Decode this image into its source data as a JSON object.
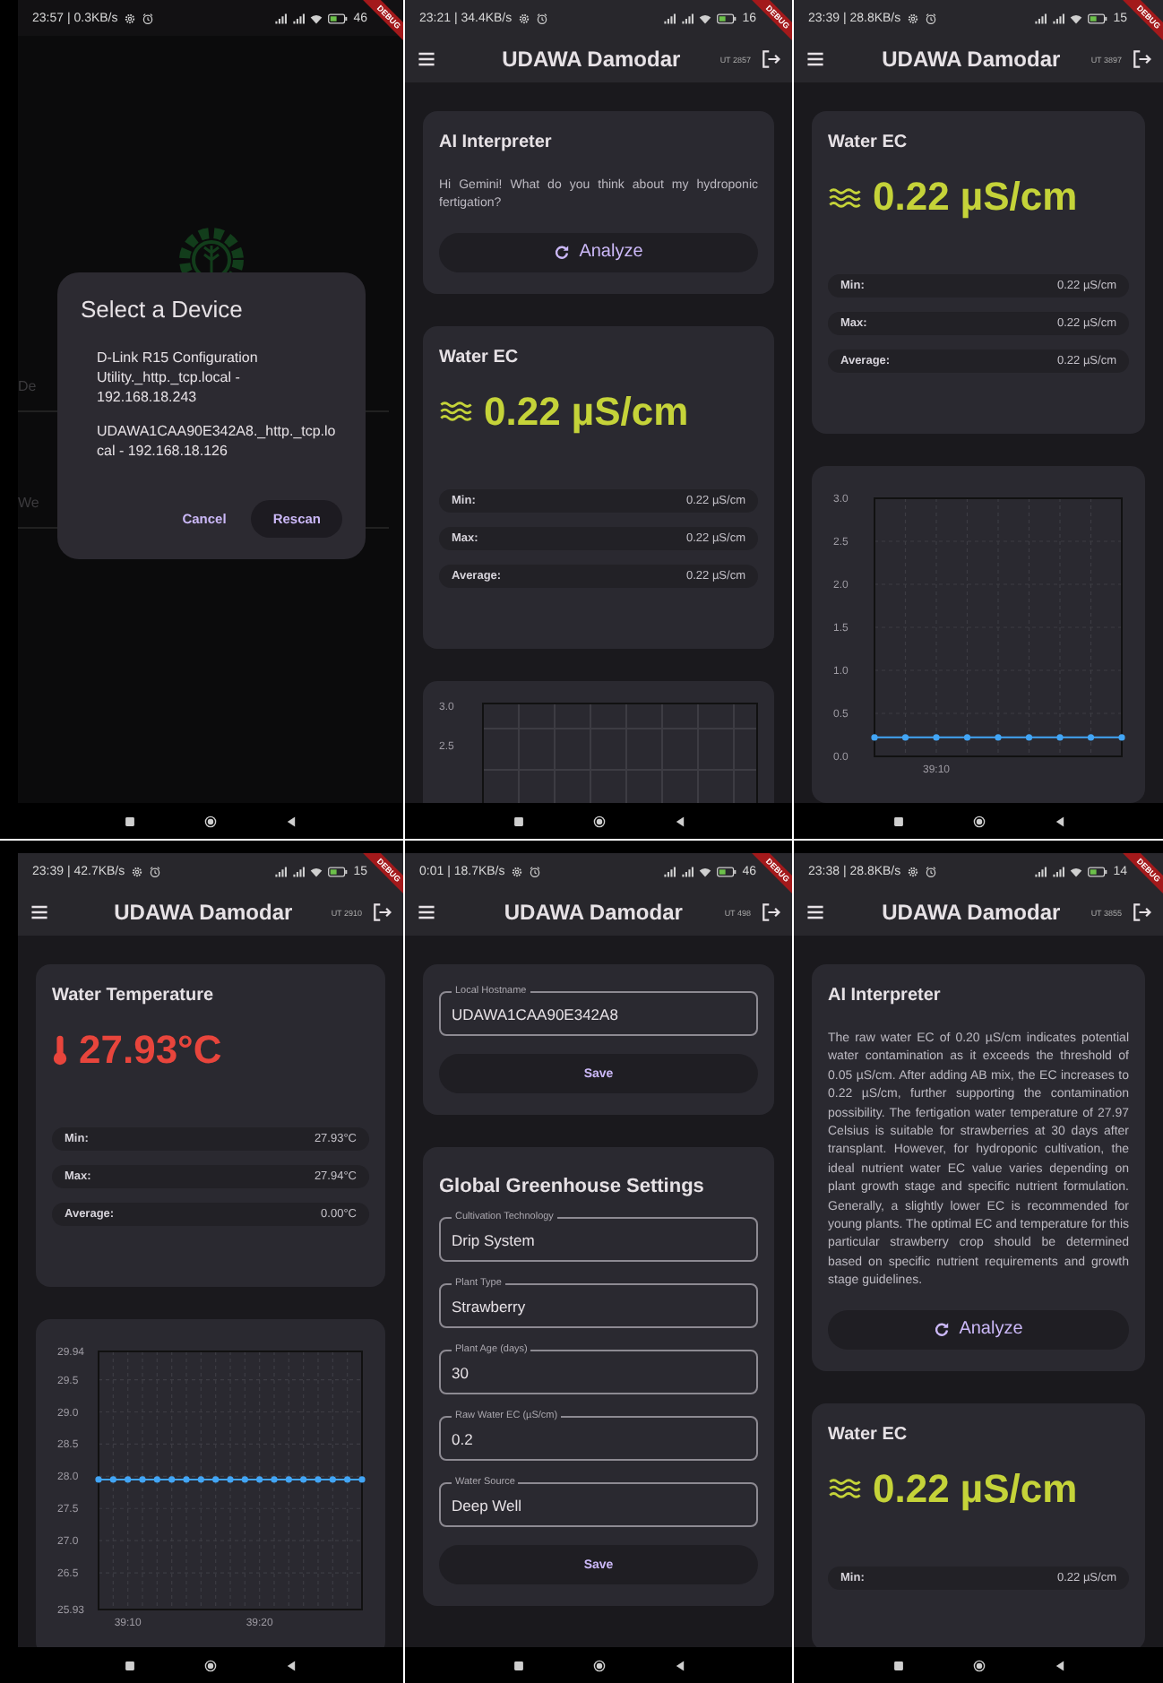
{
  "screens": [
    {
      "kind": "dialog",
      "status": {
        "text": "23:57 | 0.3KB/s",
        "battery": "46"
      },
      "debug_banner": "DEBUG",
      "background_labels": [
        "De",
        "We"
      ],
      "dialog": {
        "title": "Select a Device",
        "options": [
          "D-Link R15 Configuration Utility._http._tcp.local - 192.168.18.243",
          "UDAWA1CAA90E342A8._http._tcp.local - 192.168.18.126"
        ],
        "buttons": [
          {
            "label": "Cancel",
            "kind": "text"
          },
          {
            "label": "Rescan",
            "kind": "tonal"
          }
        ]
      }
    },
    {
      "kind": "app",
      "status": {
        "text": "23:21 | 34.4KB/s",
        "battery": "16"
      },
      "debug_banner": "DEBUG",
      "app_bar": {
        "title": "UDAWA Damodar",
        "uptime": "UT 2857"
      },
      "cards": [
        {
          "kind": "ai",
          "title": "AI Interpreter",
          "text": "Hi Gemini! What do you think about my hydroponic fertigation?",
          "button": "Analyze"
        },
        {
          "kind": "ec_reading",
          "title": "Water EC",
          "value": "0.22 µS/cm",
          "color": "#c5d339",
          "stats": [
            {
              "label": "Min:",
              "value": "0.22 µS/cm"
            },
            {
              "label": "Max:",
              "value": "0.22 µS/cm"
            },
            {
              "label": "Average:",
              "value": "0.22 µS/cm"
            }
          ]
        },
        {
          "kind": "chart_preview",
          "tick_labels": [
            "3.0",
            "2.5"
          ]
        }
      ]
    },
    {
      "kind": "app",
      "status": {
        "text": "23:39 | 28.8KB/s",
        "battery": "15"
      },
      "debug_banner": "DEBUG",
      "app_bar": {
        "title": "UDAWA Damodar",
        "uptime": "UT 3897"
      },
      "cards": [
        {
          "kind": "ec_reading",
          "title": "Water EC",
          "value": "0.22 µS/cm",
          "color": "#c5d339",
          "stats": [
            {
              "label": "Min:",
              "value": "0.22 µS/cm"
            },
            {
              "label": "Max:",
              "value": "0.22 µS/cm"
            },
            {
              "label": "Average:",
              "value": "0.22 µS/cm"
            }
          ]
        },
        {
          "kind": "chart",
          "chart_data": {
            "type": "line",
            "grid": true,
            "categories": [
              null,
              null,
              "39:10",
              null,
              null,
              null,
              null,
              null,
              null
            ],
            "ylim": [
              0,
              3
            ],
            "yticks": [
              {
                "value": 0,
                "label": "0.0"
              },
              {
                "value": 0.5,
                "label": "0.5"
              },
              {
                "value": 1,
                "label": "1.0"
              },
              {
                "value": 1.5,
                "label": "1.5"
              },
              {
                "value": 2,
                "label": "2.0"
              },
              {
                "value": 2.5,
                "label": "2.5"
              },
              {
                "value": 3,
                "label": "3.0"
              }
            ],
            "series": [
              {
                "color": "#42a5f5",
                "marker": true,
                "values": [
                  0.22,
                  0.22,
                  0.22,
                  0.22,
                  0.22,
                  0.22,
                  0.22,
                  0.22,
                  0.22
                ]
              }
            ]
          }
        }
      ]
    },
    {
      "kind": "app",
      "status": {
        "text": "23:39 | 42.7KB/s",
        "battery": "15"
      },
      "debug_banner": "DEBUG",
      "app_bar": {
        "title": "UDAWA Damodar",
        "uptime": "UT 2910"
      },
      "cards": [
        {
          "kind": "temperature_reading",
          "title": "Water Temperature",
          "value": "27.93°C",
          "color": "#e8453c",
          "stats": [
            {
              "label": "Min:",
              "value": "27.93°C"
            },
            {
              "label": "Max:",
              "value": "27.94°C"
            },
            {
              "label": "Average:",
              "value": "0.00°C"
            }
          ]
        },
        {
          "kind": "chart",
          "chart_data": {
            "type": "line",
            "grid": true,
            "categories": [
              null,
              null,
              "39:10",
              null,
              null,
              null,
              null,
              null,
              null,
              null,
              null,
              "39:20",
              null,
              null,
              null,
              null,
              null,
              null,
              null
            ],
            "ylim": [
              25.93,
              29.94
            ],
            "yticks": [
              {
                "value": 25.93,
                "label": "25.93"
              },
              {
                "value": 26.5,
                "label": "26.5"
              },
              {
                "value": 27,
                "label": "27.0"
              },
              {
                "value": 27.5,
                "label": "27.5"
              },
              {
                "value": 28,
                "label": "28.0"
              },
              {
                "value": 28.5,
                "label": "28.5"
              },
              {
                "value": 29,
                "label": "29.0"
              },
              {
                "value": 29.5,
                "label": "29.5"
              },
              {
                "value": 29.94,
                "label": "29.94"
              }
            ],
            "series": [
              {
                "color": "#42a5f5",
                "marker": true,
                "values": [
                  27.95,
                  27.95,
                  27.95,
                  27.95,
                  27.95,
                  27.95,
                  27.95,
                  27.95,
                  27.95,
                  27.95,
                  27.95,
                  27.95,
                  27.95,
                  27.95,
                  27.95,
                  27.95,
                  27.95,
                  27.95,
                  27.95
                ]
              }
            ]
          }
        }
      ]
    },
    {
      "kind": "app",
      "status": {
        "text": "0:01 | 18.7KB/s",
        "battery": "46"
      },
      "debug_banner": "DEBUG",
      "app_bar": {
        "title": "UDAWA Damodar",
        "uptime": "UT 498"
      },
      "cards": [
        {
          "kind": "form",
          "fields": [
            {
              "label": "Local Hostname",
              "value": "UDAWA1CAA90E342A8"
            }
          ],
          "button": "Save"
        },
        {
          "kind": "form",
          "title": "Global Greenhouse Settings",
          "fields": [
            {
              "label": "Cultivation Technology",
              "value": "Drip System"
            },
            {
              "label": "Plant Type",
              "value": "Strawberry"
            },
            {
              "label": "Plant Age (days)",
              "value": "30"
            },
            {
              "label": "Raw Water EC (µS/cm)",
              "value": "0.2"
            },
            {
              "label": "Water Source",
              "value": "Deep Well"
            }
          ],
          "button": "Save"
        }
      ]
    },
    {
      "kind": "app",
      "status": {
        "text": "23:38 | 28.8KB/s",
        "battery": "14"
      },
      "debug_banner": "DEBUG",
      "app_bar": {
        "title": "UDAWA Damodar",
        "uptime": "UT 3855"
      },
      "cards": [
        {
          "kind": "ai",
          "title": "AI Interpreter",
          "text": "The raw water EC of 0.20 µS/cm indicates potential water contamination as it exceeds the threshold of 0.05 µS/cm. After adding AB mix, the EC increases to 0.22 µS/cm, further supporting the contamination possibility. The fertigation water temperature of 27.97 Celsius is suitable for strawberries at 30 days after transplant. However, for hydroponic cultivation, the ideal nutrient water EC value varies depending on plant growth stage and specific nutrient formulation. Generally, a slightly lower EC is recommended for young plants. The optimal EC and temperature for this particular strawberry crop should be determined based on specific nutrient requirements and growth stage guidelines.",
          "button": "Analyze"
        },
        {
          "kind": "ec_reading",
          "title": "Water EC",
          "value": "0.22 µS/cm",
          "color": "#c5d339",
          "stats": [
            {
              "label": "Min:",
              "value": "0.22 µS/cm"
            }
          ]
        }
      ]
    }
  ]
}
